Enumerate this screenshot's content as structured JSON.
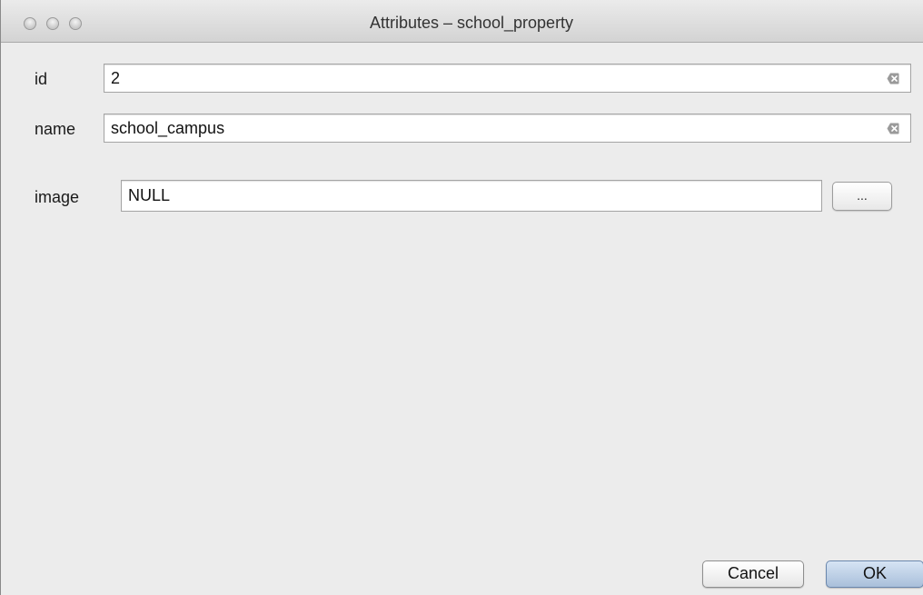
{
  "window": {
    "title": "Attributes – school_property"
  },
  "form": {
    "fields": [
      {
        "label": "id",
        "value": "2"
      },
      {
        "label": "name",
        "value": "school_campus"
      },
      {
        "label": "image",
        "value": "NULL"
      }
    ],
    "browse_label": "..."
  },
  "buttons": {
    "cancel": "Cancel",
    "ok": "OK"
  },
  "icons": {
    "clear": "clear-icon",
    "traffic_lights": [
      "close-window-icon",
      "minimize-window-icon",
      "zoom-window-icon"
    ]
  }
}
